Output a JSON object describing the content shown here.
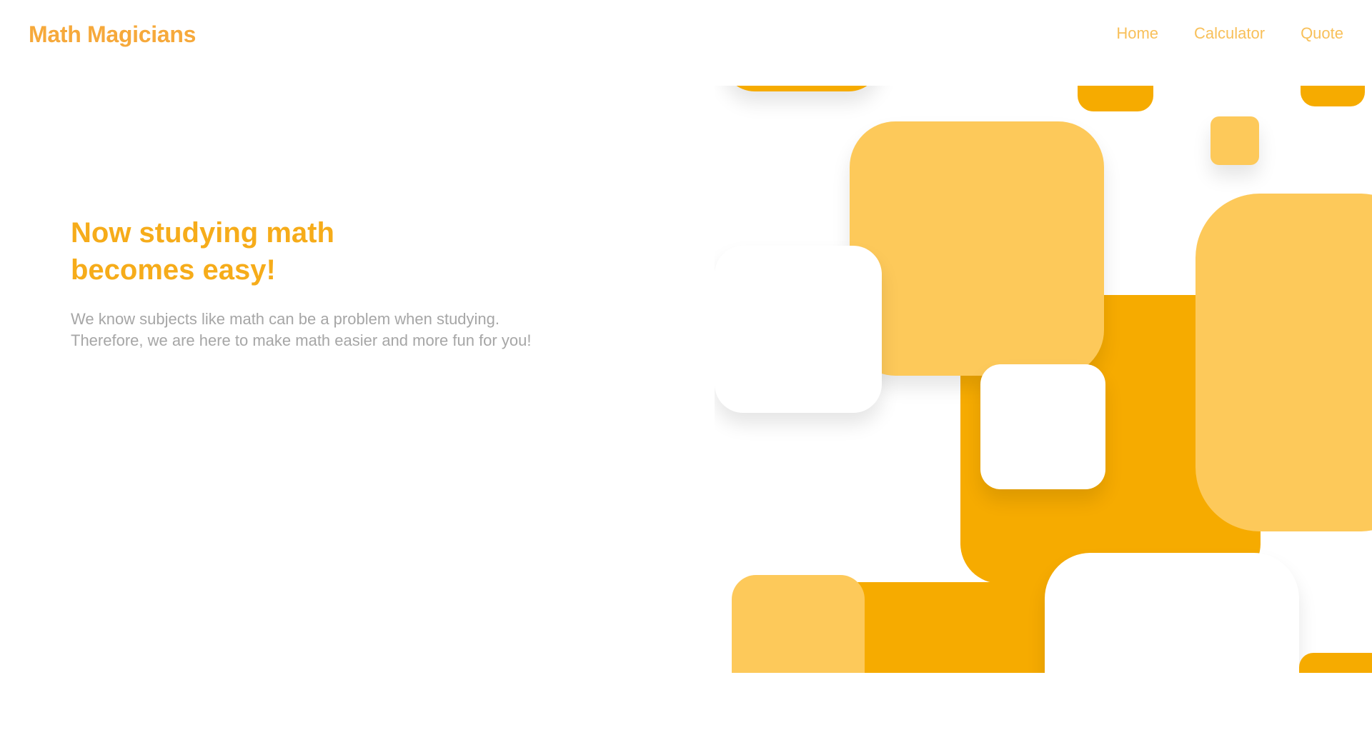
{
  "header": {
    "brand": "Math Magicians",
    "nav": [
      {
        "label": "Home"
      },
      {
        "label": "Calculator"
      },
      {
        "label": "Quote"
      }
    ]
  },
  "hero": {
    "heading": "Now studying math\nbecomes easy!",
    "subtitle": "We know subjects like math can be a problem when studying.\nTherefore, we are here to make math easier and more fun for you!"
  },
  "colors": {
    "brand": "#f6a93b",
    "nav": "#f8c05a",
    "heading": "#f6ac1a",
    "subtitle": "#a6a6a6",
    "tile_dark": "#f6ab00",
    "tile_light": "#fdc95a"
  }
}
